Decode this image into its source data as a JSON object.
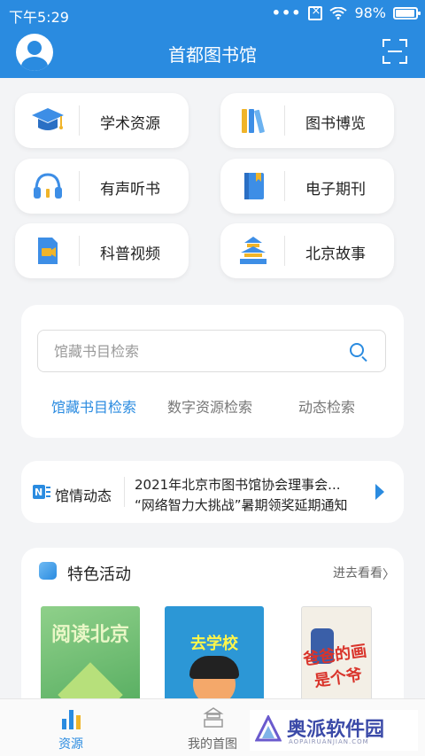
{
  "status_bar": {
    "time": "下午5:29",
    "signal_dots": "•••",
    "battery": "98%"
  },
  "header": {
    "title": "首都图书馆"
  },
  "categories": [
    {
      "label": "学术资源",
      "icon": "graduation-cap-icon"
    },
    {
      "label": "图书博览",
      "icon": "books-icon"
    },
    {
      "label": "有声听书",
      "icon": "headphones-icon"
    },
    {
      "label": "电子期刊",
      "icon": "ebook-icon"
    },
    {
      "label": "科普视频",
      "icon": "video-camera-icon"
    },
    {
      "label": "北京故事",
      "icon": "temple-icon"
    }
  ],
  "search": {
    "placeholder": "馆藏书目检索",
    "tabs": [
      "馆藏书目检索",
      "数字资源检索",
      "动态检索"
    ],
    "active_tab": 0
  },
  "news": {
    "label": "馆情动态",
    "items": [
      "2021年北京市图书馆协会理事会...",
      "“网络智力大挑战”暑期领奖延期通知"
    ]
  },
  "activities": {
    "title": "特色活动",
    "more": "进去看看",
    "books": [
      {
        "title": "阅读北京"
      },
      {
        "title": "去学校"
      },
      {
        "title": "爸爸的画是个爷"
      }
    ]
  },
  "bottom_nav": {
    "items": [
      {
        "label": "资源",
        "icon": "bar-chart-icon"
      },
      {
        "label": "我的首图",
        "icon": "library-building-icon"
      }
    ],
    "active": 0
  },
  "watermark": {
    "text": "奥派软件园",
    "sub": "AOPAIRUANJIAN.COM"
  },
  "colors": {
    "primary": "#2a8be0",
    "background": "#f3f4f6"
  }
}
